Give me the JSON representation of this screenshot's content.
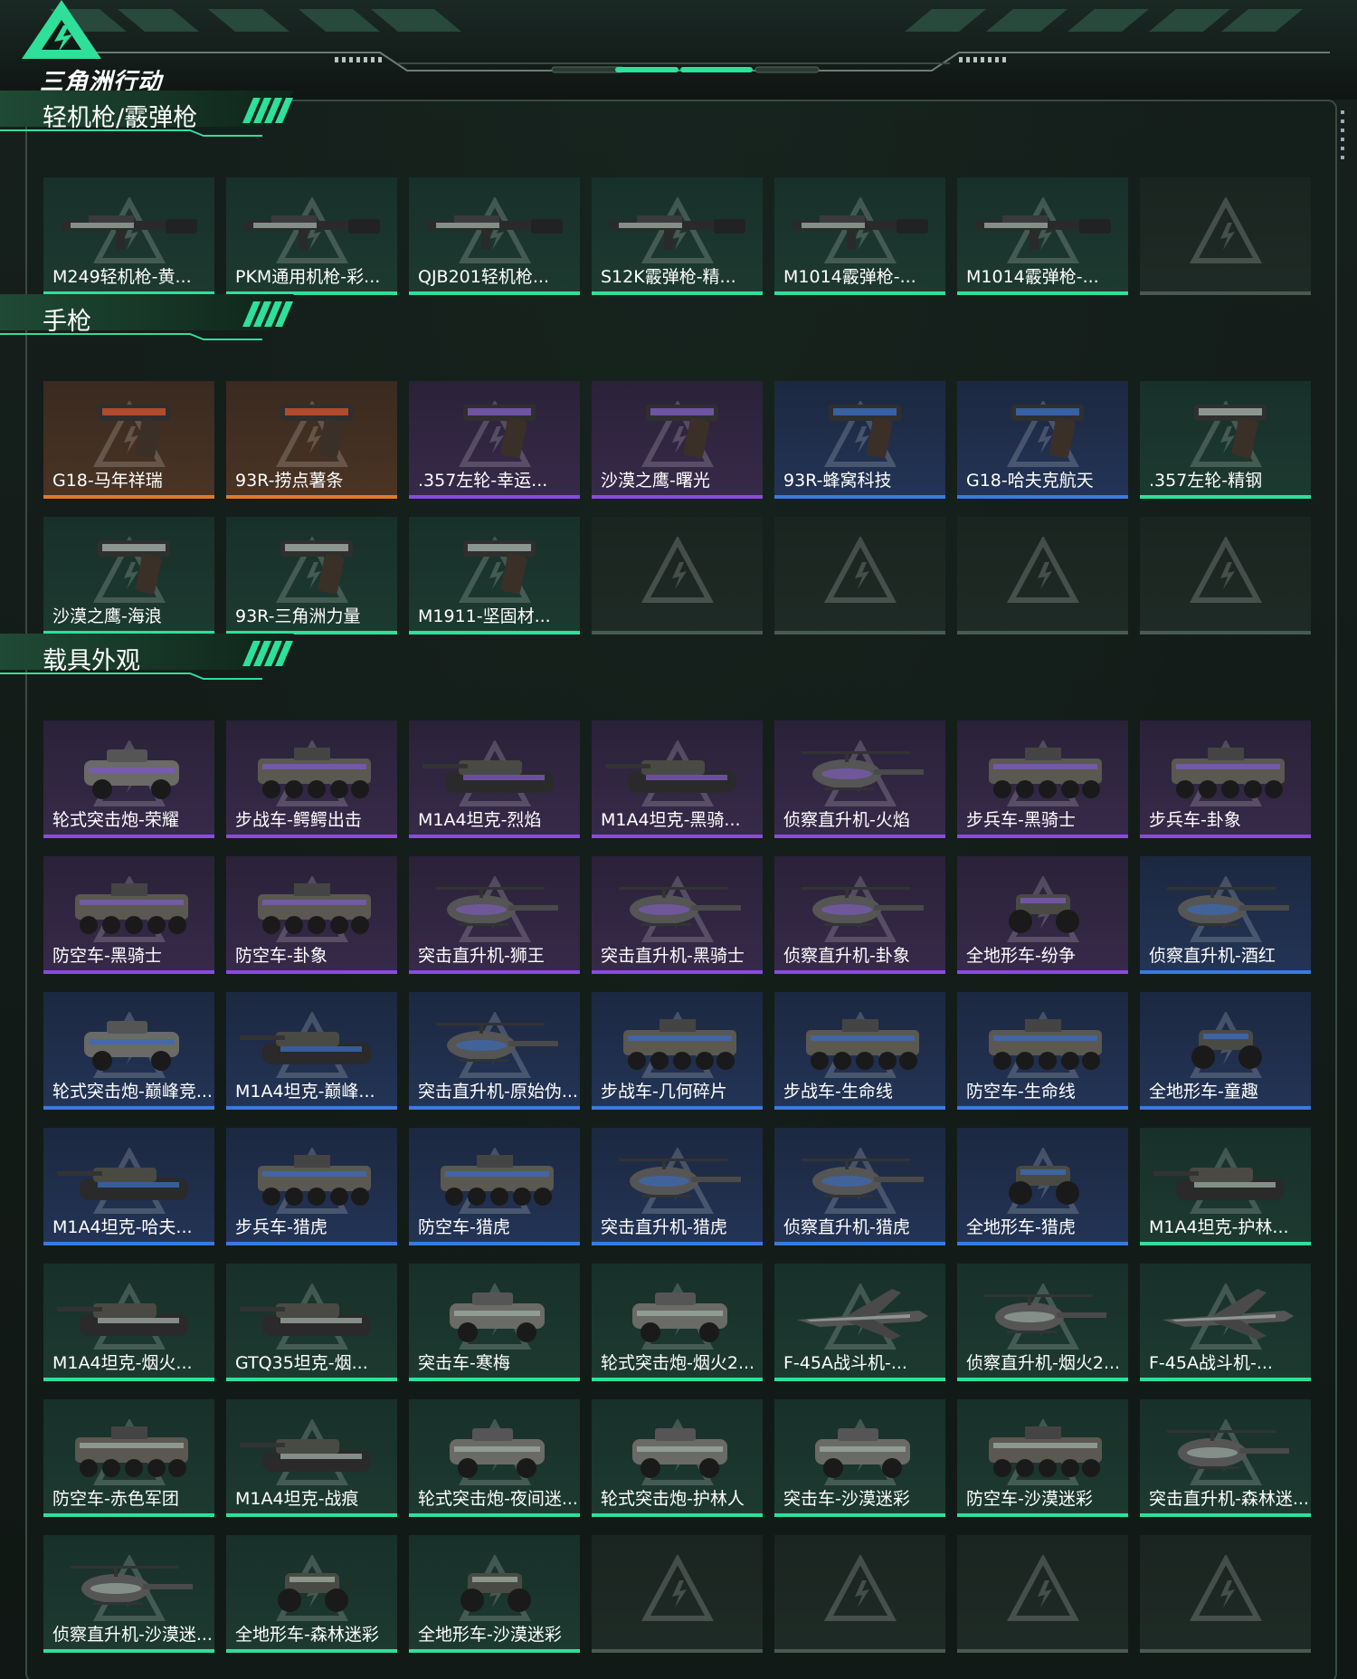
{
  "header": {
    "logo_text": "三角洲行动"
  },
  "colors": {
    "accent": "#2ee09a",
    "gold": "#e07a2a",
    "purple": "#8a4ae0",
    "blue": "#3a7ae0"
  },
  "sections": [
    {
      "title": "轻机枪/霰弹枪",
      "rows": [
        [
          {
            "label": "M249轻机枪-黄...",
            "tier": "green",
            "kind": "rifle"
          },
          {
            "label": "PKM通用机枪-彩...",
            "tier": "green",
            "kind": "rifle"
          },
          {
            "label": "QJB201轻机枪...",
            "tier": "green",
            "kind": "rifle"
          },
          {
            "label": "S12K霰弹枪-精...",
            "tier": "green",
            "kind": "rifle"
          },
          {
            "label": "M1014霰弹枪-...",
            "tier": "green",
            "kind": "rifle"
          },
          {
            "label": "M1014霰弹枪-...",
            "tier": "green",
            "kind": "rifle"
          },
          {
            "label": "",
            "tier": "empty",
            "kind": "empty"
          }
        ]
      ]
    },
    {
      "title": "手枪",
      "rows": [
        [
          {
            "label": "G18-马年祥瑞",
            "tier": "gold",
            "kind": "pistol"
          },
          {
            "label": "93R-捞点薯条",
            "tier": "gold",
            "kind": "pistol"
          },
          {
            "label": ".357左轮-幸运...",
            "tier": "purple",
            "kind": "pistol"
          },
          {
            "label": "沙漠之鹰-曙光",
            "tier": "purple",
            "kind": "pistol"
          },
          {
            "label": "93R-蜂窝科技",
            "tier": "blue",
            "kind": "pistol"
          },
          {
            "label": "G18-哈夫克航天",
            "tier": "blue",
            "kind": "pistol"
          },
          {
            "label": ".357左轮-精钢",
            "tier": "green",
            "kind": "pistol"
          }
        ],
        [
          {
            "label": "沙漠之鹰-海浪",
            "tier": "green",
            "kind": "pistol"
          },
          {
            "label": "93R-三角洲力量",
            "tier": "green",
            "kind": "pistol"
          },
          {
            "label": "M1911-坚固材...",
            "tier": "green",
            "kind": "pistol"
          },
          {
            "label": "",
            "tier": "empty",
            "kind": "empty"
          },
          {
            "label": "",
            "tier": "empty",
            "kind": "empty"
          },
          {
            "label": "",
            "tier": "empty",
            "kind": "empty"
          },
          {
            "label": "",
            "tier": "empty",
            "kind": "empty"
          }
        ]
      ]
    },
    {
      "title": "载具外观",
      "rows": [
        [
          {
            "label": "轮式突击炮-荣耀",
            "tier": "purple",
            "kind": "car"
          },
          {
            "label": "步战车-鳄鳄出击",
            "tier": "purple",
            "kind": "apc"
          },
          {
            "label": "M1A4坦克-烈焰",
            "tier": "purple",
            "kind": "tank"
          },
          {
            "label": "M1A4坦克-黑骑...",
            "tier": "purple",
            "kind": "tank"
          },
          {
            "label": "侦察直升机-火焰",
            "tier": "purple",
            "kind": "heli"
          },
          {
            "label": "步兵车-黑骑士",
            "tier": "purple",
            "kind": "apc"
          },
          {
            "label": "步兵车-卦象",
            "tier": "purple",
            "kind": "apc"
          }
        ],
        [
          {
            "label": "防空车-黑骑士",
            "tier": "purple",
            "kind": "apc"
          },
          {
            "label": "防空车-卦象",
            "tier": "purple",
            "kind": "apc"
          },
          {
            "label": "突击直升机-狮王",
            "tier": "purple",
            "kind": "heli"
          },
          {
            "label": "突击直升机-黑骑士",
            "tier": "purple",
            "kind": "heli"
          },
          {
            "label": "侦察直升机-卦象",
            "tier": "purple",
            "kind": "heli"
          },
          {
            "label": "全地形车-纷争",
            "tier": "purple",
            "kind": "atv"
          },
          {
            "label": "侦察直升机-酒红",
            "tier": "blue",
            "kind": "heli"
          }
        ],
        [
          {
            "label": "轮式突击炮-巅峰竞...",
            "tier": "blue",
            "kind": "car"
          },
          {
            "label": "M1A4坦克-巅峰...",
            "tier": "blue",
            "kind": "tank"
          },
          {
            "label": "突击直升机-原始伪...",
            "tier": "blue",
            "kind": "heli"
          },
          {
            "label": "步战车-几何碎片",
            "tier": "blue",
            "kind": "apc"
          },
          {
            "label": "步战车-生命线",
            "tier": "blue",
            "kind": "apc"
          },
          {
            "label": "防空车-生命线",
            "tier": "blue",
            "kind": "apc"
          },
          {
            "label": "全地形车-童趣",
            "tier": "blue",
            "kind": "atv"
          }
        ],
        [
          {
            "label": "M1A4坦克-哈夫...",
            "tier": "blue",
            "kind": "tank"
          },
          {
            "label": "步兵车-猎虎",
            "tier": "blue",
            "kind": "apc"
          },
          {
            "label": "防空车-猎虎",
            "tier": "blue",
            "kind": "apc"
          },
          {
            "label": "突击直升机-猎虎",
            "tier": "blue",
            "kind": "heli"
          },
          {
            "label": "侦察直升机-猎虎",
            "tier": "blue",
            "kind": "heli"
          },
          {
            "label": "全地形车-猎虎",
            "tier": "blue",
            "kind": "atv"
          },
          {
            "label": "M1A4坦克-护林...",
            "tier": "green",
            "kind": "tank"
          }
        ],
        [
          {
            "label": "M1A4坦克-烟火...",
            "tier": "green",
            "kind": "tank"
          },
          {
            "label": "GTQ35坦克-烟...",
            "tier": "green",
            "kind": "tank"
          },
          {
            "label": "突击车-寒梅",
            "tier": "green",
            "kind": "car"
          },
          {
            "label": "轮式突击炮-烟火2...",
            "tier": "green",
            "kind": "car"
          },
          {
            "label": "F-45A战斗机-...",
            "tier": "green",
            "kind": "jet"
          },
          {
            "label": "侦察直升机-烟火2...",
            "tier": "green",
            "kind": "heli"
          },
          {
            "label": "F-45A战斗机-...",
            "tier": "green",
            "kind": "jet"
          }
        ],
        [
          {
            "label": "防空车-赤色军团",
            "tier": "green",
            "kind": "apc"
          },
          {
            "label": "M1A4坦克-战痕",
            "tier": "green",
            "kind": "tank"
          },
          {
            "label": "轮式突击炮-夜间迷...",
            "tier": "green",
            "kind": "car"
          },
          {
            "label": "轮式突击炮-护林人",
            "tier": "green",
            "kind": "car"
          },
          {
            "label": "突击车-沙漠迷彩",
            "tier": "green",
            "kind": "car"
          },
          {
            "label": "防空车-沙漠迷彩",
            "tier": "green",
            "kind": "apc"
          },
          {
            "label": "突击直升机-森林迷...",
            "tier": "green",
            "kind": "heli"
          }
        ],
        [
          {
            "label": "侦察直升机-沙漠迷...",
            "tier": "green",
            "kind": "heli"
          },
          {
            "label": "全地形车-森林迷彩",
            "tier": "green",
            "kind": "atv"
          },
          {
            "label": "全地形车-沙漠迷彩",
            "tier": "green",
            "kind": "atv"
          },
          {
            "label": "",
            "tier": "empty",
            "kind": "empty"
          },
          {
            "label": "",
            "tier": "empty",
            "kind": "empty"
          },
          {
            "label": "",
            "tier": "empty",
            "kind": "empty"
          },
          {
            "label": "",
            "tier": "empty",
            "kind": "empty"
          }
        ]
      ]
    }
  ]
}
